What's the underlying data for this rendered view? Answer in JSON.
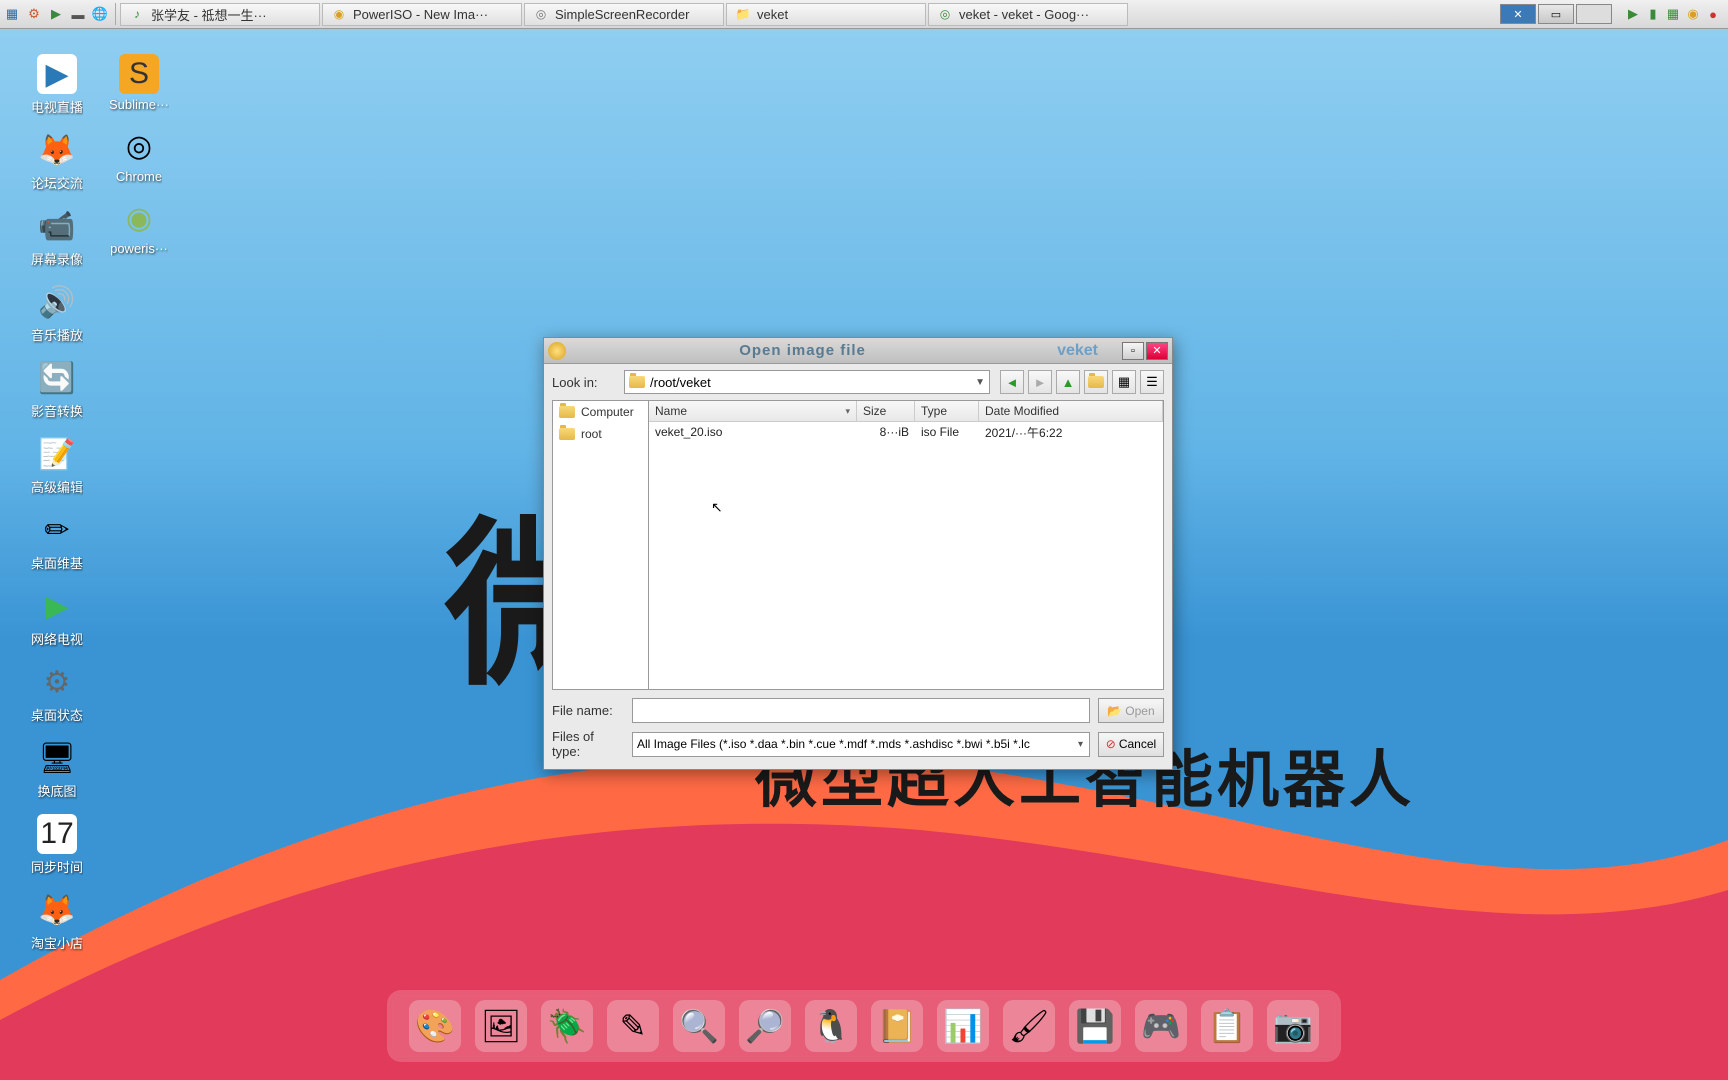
{
  "taskbar": {
    "items": [
      {
        "label": "张学友 - 祗想一生···",
        "icon": "♪",
        "color": "#3a8a3a"
      },
      {
        "label": "PowerISO - New Ima···",
        "icon": "◉",
        "color": "#d8a020"
      },
      {
        "label": "SimpleScreenRecorder",
        "icon": "◎",
        "color": "#777"
      },
      {
        "label": "veket",
        "icon": "📁",
        "color": "#5a8ad8"
      },
      {
        "label": "veket - veket - Goog···",
        "icon": "◎",
        "color": "#3a8a3a"
      }
    ]
  },
  "desktop_icons_col1": [
    {
      "label": "电视直播",
      "glyph": "▶",
      "bg": "#fff",
      "fg": "#2a7ab8"
    },
    {
      "label": "论坛交流",
      "glyph": "🦊",
      "bg": "",
      "fg": ""
    },
    {
      "label": "屏幕录像",
      "glyph": "📹",
      "bg": "",
      "fg": ""
    },
    {
      "label": "音乐播放",
      "glyph": "🔊",
      "bg": "",
      "fg": ""
    },
    {
      "label": "影音转换",
      "glyph": "🔄",
      "bg": "",
      "fg": ""
    },
    {
      "label": "高级编辑",
      "glyph": "📝",
      "bg": "",
      "fg": ""
    },
    {
      "label": "桌面维基",
      "glyph": "✏",
      "bg": "",
      "fg": ""
    },
    {
      "label": "网络电视",
      "glyph": "▶",
      "bg": "",
      "fg": "#3ab856"
    },
    {
      "label": "桌面状态",
      "glyph": "⚙",
      "bg": "",
      "fg": "#666"
    },
    {
      "label": "换底图",
      "glyph": "🖥",
      "bg": "",
      "fg": ""
    },
    {
      "label": "同步时间",
      "glyph": "17",
      "bg": "#fff",
      "fg": "#222"
    },
    {
      "label": "淘宝小店",
      "glyph": "🦊",
      "bg": "",
      "fg": ""
    }
  ],
  "desktop_icons_col2": [
    {
      "label": "Sublime···",
      "glyph": "S",
      "bg": "#f5a623",
      "fg": "#333"
    },
    {
      "label": "Chrome",
      "glyph": "◎",
      "bg": "",
      "fg": ""
    },
    {
      "label": "poweris···",
      "glyph": "◉",
      "bg": "",
      "fg": "#8ab85a"
    }
  ],
  "wallpaper": {
    "big": "微",
    "line": "微型超人工智能机器人"
  },
  "dialog": {
    "title": "Open image file",
    "extra": "veket",
    "look_in_label": "Look in:",
    "path": "/root/veket",
    "side_items": [
      {
        "label": "Computer"
      },
      {
        "label": "root"
      }
    ],
    "columns": {
      "name": "Name",
      "size": "Size",
      "type": "Type",
      "date": "Date Modified"
    },
    "files": [
      {
        "name": "veket_20.iso",
        "size": "8···iB",
        "type": "iso File",
        "date": "2021/···午6:22"
      }
    ],
    "file_name_label": "File name:",
    "file_name_value": "",
    "files_of_type_label": "Files of type:",
    "file_filter": "All Image Files (*.iso *.daa *.bin *.cue *.mdf *.mds *.ashdisc *.bwi *.b5i *.lc",
    "open_label": "Open",
    "cancel_label": "Cancel"
  },
  "dock": [
    "🎨",
    "🖼",
    "🪲",
    "✎",
    "🔍",
    "🔎",
    "🐧",
    "📔",
    "📊",
    "🖌",
    "💾",
    "🎮",
    "📋",
    "📷"
  ]
}
